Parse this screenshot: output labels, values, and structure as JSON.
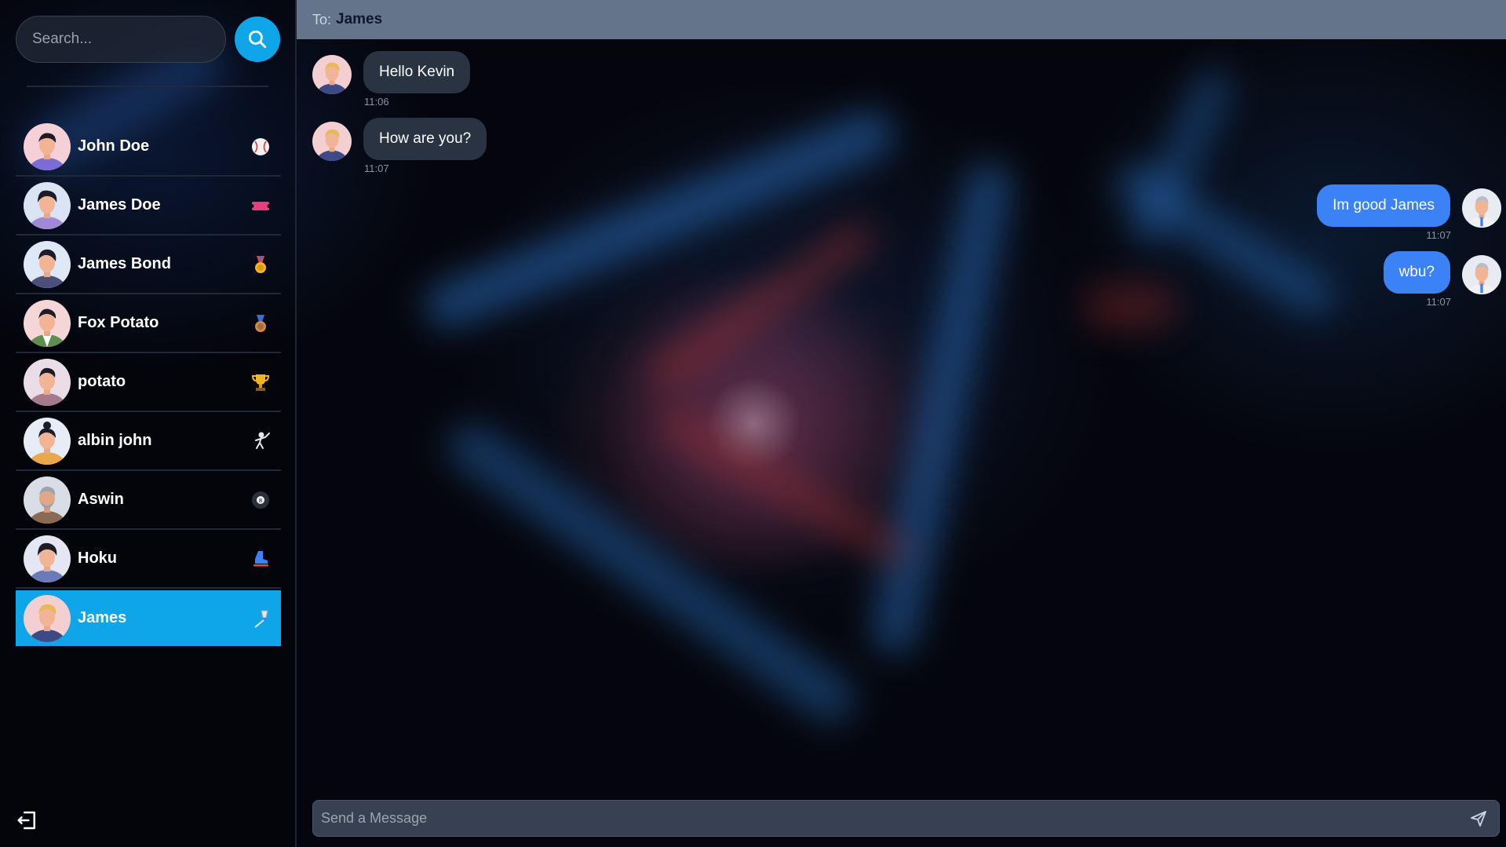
{
  "search": {
    "placeholder": "Search..."
  },
  "contacts": [
    {
      "name": "John Doe",
      "status_icon": "baseball-icon",
      "active": false
    },
    {
      "name": "James Doe",
      "status_icon": "ticket-icon",
      "active": false
    },
    {
      "name": "James Bond",
      "status_icon": "medal-icon",
      "active": false
    },
    {
      "name": "Fox Potato",
      "status_icon": "bronze-medal-icon",
      "active": false
    },
    {
      "name": "potato",
      "status_icon": "trophy-icon",
      "active": false
    },
    {
      "name": "albin john",
      "status_icon": "fencing-icon",
      "active": false
    },
    {
      "name": "Aswin",
      "status_icon": "eight-ball-icon",
      "active": false
    },
    {
      "name": "Hoku",
      "status_icon": "skate-icon",
      "active": false
    },
    {
      "name": "James",
      "status_icon": "badminton-icon",
      "active": true
    }
  ],
  "chat": {
    "to_label": "To:",
    "to_name": "James",
    "messages": [
      {
        "text": "Hello Kevin",
        "time": "11:06",
        "direction": "incoming"
      },
      {
        "text": "How are you?",
        "time": "11:07",
        "direction": "incoming"
      },
      {
        "text": "Im good James",
        "time": "11:07",
        "direction": "outgoing"
      },
      {
        "text": "wbu?",
        "time": "11:07",
        "direction": "outgoing"
      }
    ],
    "compose_placeholder": "Send a Message"
  },
  "colors": {
    "accent": "#0ea5e9",
    "outgoing_bubble": "#3b82f6",
    "incoming_bubble": "#293341",
    "header": "#64748b"
  }
}
